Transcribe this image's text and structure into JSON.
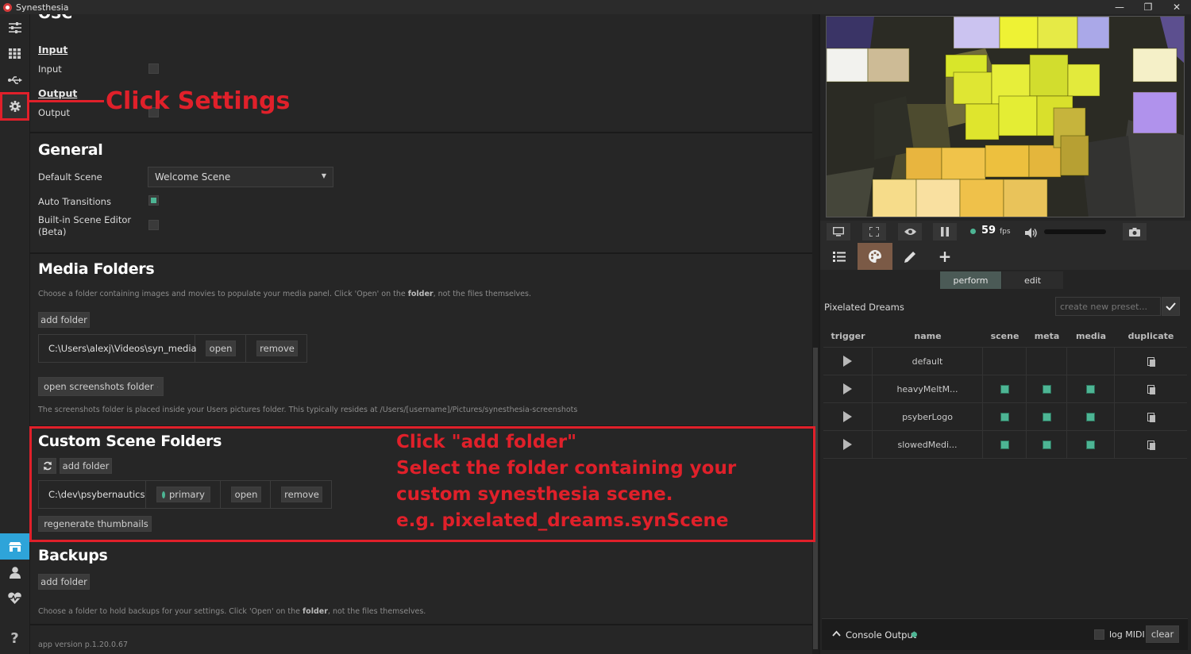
{
  "window": {
    "title": "Synesthesia",
    "min": "—",
    "restore": "❐",
    "close": "✕"
  },
  "sidebar": {
    "icons": [
      "sliders-icon",
      "grid-icon",
      "usb-icon",
      "gear-icon",
      "store-icon",
      "user-icon",
      "heart-icon",
      "help-icon"
    ]
  },
  "osc": {
    "title": "OSC",
    "input_heading": "Input",
    "input_label": "Input",
    "output_heading": "Output",
    "output_label": "Output"
  },
  "general": {
    "title": "General",
    "default_scene_label": "Default Scene",
    "default_scene_value": "Welcome Scene",
    "auto_transitions_label": "Auto Transitions",
    "auto_transitions_checked": true,
    "scene_editor_label_1": "Built-in Scene Editor",
    "scene_editor_label_2": "(Beta)",
    "scene_editor_checked": false
  },
  "media_folders": {
    "title": "Media Folders",
    "desc_before": "Choose a folder containing images and movies to populate your media panel. Click 'Open' on the ",
    "desc_bold": "folder",
    "desc_after": ", not the files themselves.",
    "add_folder": "add folder",
    "path": "C:\\Users\\alexj\\Videos\\syn_media",
    "open": "open",
    "remove": "remove",
    "open_screenshots": "open screenshots folder",
    "screenshots_desc": "The screenshots folder is placed inside your Users pictures folder. This typically resides at /Users/[username]/Pictures/synesthesia-screenshots"
  },
  "custom_scene_folders": {
    "title": "Custom Scene Folders",
    "add_folder": "add folder",
    "path": "C:\\dev\\psybernautics",
    "primary": "primary",
    "open": "open",
    "remove": "remove",
    "regenerate": "regenerate thumbnails"
  },
  "backups": {
    "title": "Backups",
    "add_folder": "add folder",
    "desc_before": "Choose a folder to hold backups for your settings. Click 'Open' on the ",
    "desc_bold": "folder",
    "desc_after": ", not the files themselves."
  },
  "footer": {
    "app_version": "app version p.1.20.0.67"
  },
  "annotations": {
    "click_settings": "Click Settings",
    "line1": "Click \"add folder\"",
    "line2": "Select the folder containing your",
    "line3": "custom synesthesia scene.",
    "line4": "e.g. pixelated_dreams.synScene",
    "color": "#e0202a"
  },
  "player": {
    "fps_value": "59",
    "fps_unit": "fps",
    "volume_level": 0.0
  },
  "right_tabs": {
    "perform": "perform",
    "edit": "edit"
  },
  "presets": {
    "scene_name": "Pixelated Dreams",
    "new_preset_placeholder": "create new preset...",
    "columns": [
      "trigger",
      "name",
      "scene",
      "meta",
      "media",
      "duplicate"
    ],
    "rows": [
      {
        "name": "default",
        "scene": false,
        "meta": false,
        "media": false
      },
      {
        "name": "heavyMeltM...",
        "scene": true,
        "meta": true,
        "media": true
      },
      {
        "name": "psyberLogo",
        "scene": true,
        "meta": true,
        "media": true
      },
      {
        "name": "slowedMedi...",
        "scene": true,
        "meta": true,
        "media": true
      }
    ]
  },
  "console": {
    "label": "Console Output",
    "log_midi": "log MIDI",
    "clear": "clear"
  },
  "colors": {
    "accent_green": "#4db594",
    "active_tab": "#7b5a46",
    "selected_sidebar": "#2ea4d9"
  }
}
